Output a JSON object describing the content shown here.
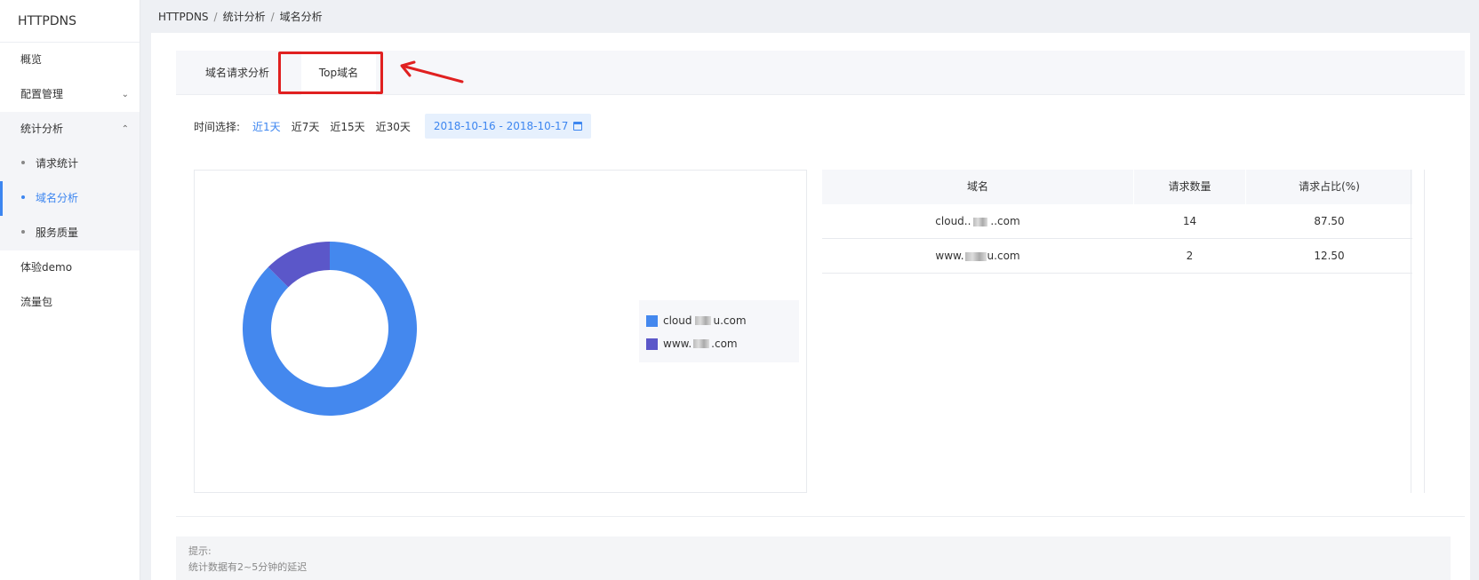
{
  "sidebar": {
    "brand": "HTTPDNS",
    "items": [
      {
        "label": "概览"
      },
      {
        "label": "配置管理"
      },
      {
        "label": "统计分析"
      },
      {
        "label": "体验demo"
      },
      {
        "label": "流量包"
      }
    ],
    "sub_items": [
      {
        "label": "请求统计"
      },
      {
        "label": "域名分析"
      },
      {
        "label": "服务质量"
      }
    ],
    "active_sub": "域名分析"
  },
  "breadcrumb": [
    "HTTPDNS",
    "统计分析",
    "域名分析"
  ],
  "tabs": [
    {
      "label": "域名请求分析"
    },
    {
      "label": "Top域名"
    }
  ],
  "active_tab": "Top域名",
  "time_filter": {
    "label": "时间选择:",
    "options": [
      "近1天",
      "近7天",
      "近15天",
      "近30天"
    ],
    "selected": "近1天",
    "date_range": "2018-10-16 - 2018-10-17"
  },
  "chart_data": {
    "type": "pie",
    "categories": [
      "cloud.■■u.com",
      "www.■■u.com"
    ],
    "values": [
      87.5,
      12.5
    ],
    "colors": [
      "#4488ee",
      "#5b57c9"
    ],
    "legend": "right",
    "title": ""
  },
  "table": {
    "headers": [
      "域名",
      "请求数量",
      "请求占比(%)"
    ],
    "rows": [
      {
        "domain_prefix": "cloud..",
        "domain_suffix": "..com",
        "count": "14",
        "ratio": "87.50"
      },
      {
        "domain_prefix": "www.",
        "domain_suffix": "u.com",
        "count": "2",
        "ratio": "12.50"
      }
    ]
  },
  "legend_labels": {
    "item1_prefix": "cloud",
    "item1_suffix": "u.com",
    "item2_prefix": "www.",
    "item2_suffix": ".com"
  },
  "tips": {
    "title": "提示:",
    "text": "统计数据有2~5分钟的延迟"
  },
  "colors": {
    "accent": "#3d86f0",
    "annotation_red": "#e02020"
  }
}
